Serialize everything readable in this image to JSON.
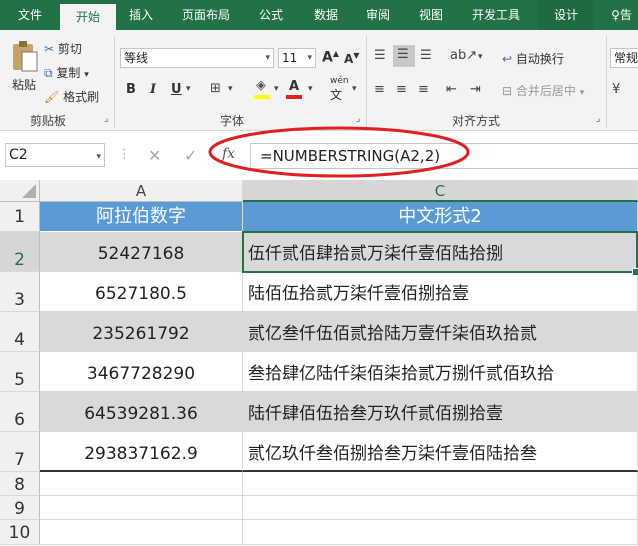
{
  "tabs": [
    "文件",
    "开始",
    "插入",
    "页面布局",
    "公式",
    "数据",
    "审阅",
    "视图",
    "开发工具",
    "设计",
    "告"
  ],
  "ribbon": {
    "paste": "粘贴",
    "cut": "剪切",
    "copy": "复制",
    "format_painter": "格式刷",
    "clipboard_group": "剪贴板",
    "font_name": "等线",
    "font_size": "11",
    "font_group": "字体",
    "bold": "B",
    "italic": "I",
    "underline": "U",
    "phonetic": "wén",
    "wrap_text": "自动换行",
    "merge_center": "合并后居中",
    "alignment_group": "对齐方式",
    "number_format": "常规",
    "increase_font": "A",
    "decrease_font": "A"
  },
  "formula_bar": {
    "name_box": "C2",
    "fx": "fx",
    "formula": "=NUMBERSTRING(A2,2)"
  },
  "columns": [
    "A",
    "C"
  ],
  "rows": [
    "1",
    "2",
    "3",
    "4",
    "5",
    "6",
    "7",
    "8",
    "9",
    "10"
  ],
  "header": {
    "a": "阿拉伯数字",
    "c": "中文形式2"
  },
  "data": [
    {
      "a": "52427168",
      "c": "伍仟贰佰肆拾贰万柒仟壹佰陆拾捌"
    },
    {
      "a": "6527180.5",
      "c": "陆佰伍拾贰万柒仟壹佰捌拾壹"
    },
    {
      "a": "235261792",
      "c": "贰亿叁仟伍佰贰拾陆万壹仟柒佰玖拾贰"
    },
    {
      "a": "3467728290",
      "c": "叁拾肆亿陆仟柒佰柒拾贰万捌仟贰佰玖拾"
    },
    {
      "a": "64539281.36",
      "c": "陆仟肆佰伍拾叁万玖仟贰佰捌拾壹"
    },
    {
      "a": "293837162.9",
      "c": "贰亿玖仟叁佰捌拾叁万柒仟壹佰陆拾叁"
    }
  ],
  "colors": {
    "excel_green": "#217346",
    "header_blue": "#5b9bd5",
    "annotation_red": "#e02020",
    "alt_row": "#d9d9d9"
  }
}
